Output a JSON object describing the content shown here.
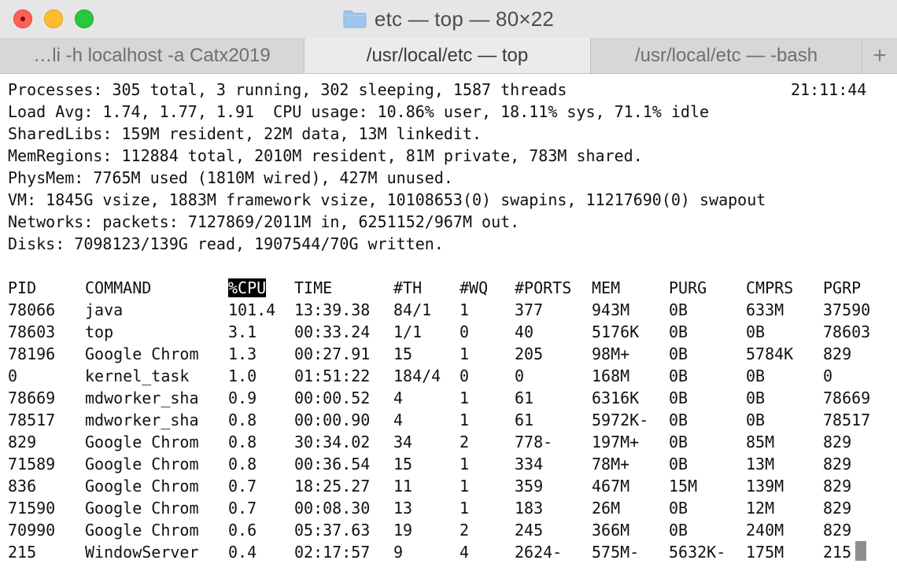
{
  "window": {
    "title": "etc — top — 80×22"
  },
  "tabs": [
    {
      "label": "…li -h localhost -a Catx2019",
      "active": false
    },
    {
      "label": "/usr/local/etc — top",
      "active": true
    },
    {
      "label": "/usr/local/etc — -bash",
      "active": false
    }
  ],
  "tab_add_label": "+",
  "summary": {
    "processes": "Processes: 305 total, 3 running, 302 sleeping, 1587 threads",
    "clock": "21:11:44",
    "load": "Load Avg: 1.74, 1.77, 1.91  CPU usage: 10.86% user, 18.11% sys, 71.1% idle",
    "sharedlibs": "SharedLibs: 159M resident, 22M data, 13M linkedit.",
    "memregions": "MemRegions: 112884 total, 2010M resident, 81M private, 783M shared.",
    "physmem": "PhysMem: 7765M used (1810M wired), 427M unused.",
    "vm": "VM: 1845G vsize, 1883M framework vsize, 10108653(0) swapins, 11217690(0) swapout",
    "networks": "Networks: packets: 7127869/2011M in, 6251152/967M out.",
    "disks": "Disks: 7098123/139G read, 1907544/70G written."
  },
  "table": {
    "headers": [
      "PID",
      "COMMAND",
      "%CPU",
      "TIME",
      "#TH",
      "#WQ",
      "#PORTS",
      "MEM",
      "PURG",
      "CMPRS",
      "PGRP"
    ],
    "sorted_column": "%CPU",
    "rows": [
      [
        "78066",
        "java",
        "101.4",
        "13:39.38",
        "84/1",
        "1",
        "377",
        "943M",
        "0B",
        "633M",
        "37590"
      ],
      [
        "78603",
        "top",
        "3.1",
        "00:33.24",
        "1/1",
        "0",
        "40",
        "5176K",
        "0B",
        "0B",
        "78603"
      ],
      [
        "78196",
        "Google Chrom",
        "1.3",
        "00:27.91",
        "15",
        "1",
        "205",
        "98M+",
        "0B",
        "5784K",
        "829"
      ],
      [
        "0",
        "kernel_task",
        "1.0",
        "01:51:22",
        "184/4",
        "0",
        "0",
        "168M",
        "0B",
        "0B",
        "0"
      ],
      [
        "78669",
        "mdworker_sha",
        "0.9",
        "00:00.52",
        "4",
        "1",
        "61",
        "6316K",
        "0B",
        "0B",
        "78669"
      ],
      [
        "78517",
        "mdworker_sha",
        "0.8",
        "00:00.90",
        "4",
        "1",
        "61",
        "5972K-",
        "0B",
        "0B",
        "78517"
      ],
      [
        "829",
        "Google Chrom",
        "0.8",
        "30:34.02",
        "34",
        "2",
        "778-",
        "197M+",
        "0B",
        "85M",
        "829"
      ],
      [
        "71589",
        "Google Chrom",
        "0.8",
        "00:36.54",
        "15",
        "1",
        "334",
        "78M+",
        "0B",
        "13M",
        "829"
      ],
      [
        "836",
        "Google Chrom",
        "0.7",
        "18:25.27",
        "11",
        "1",
        "359",
        "467M",
        "15M",
        "139M",
        "829"
      ],
      [
        "71590",
        "Google Chrom",
        "0.7",
        "00:08.30",
        "13",
        "1",
        "183",
        "26M",
        "0B",
        "12M",
        "829"
      ],
      [
        "70990",
        "Google Chrom",
        "0.6",
        "05:37.63",
        "19",
        "2",
        "245",
        "366M",
        "0B",
        "240M",
        "829"
      ],
      [
        "215",
        "WindowServer",
        "0.4",
        "02:17:57",
        "9",
        "4",
        "2624-",
        "575M-",
        "5632K-",
        "175M",
        "215"
      ]
    ]
  }
}
